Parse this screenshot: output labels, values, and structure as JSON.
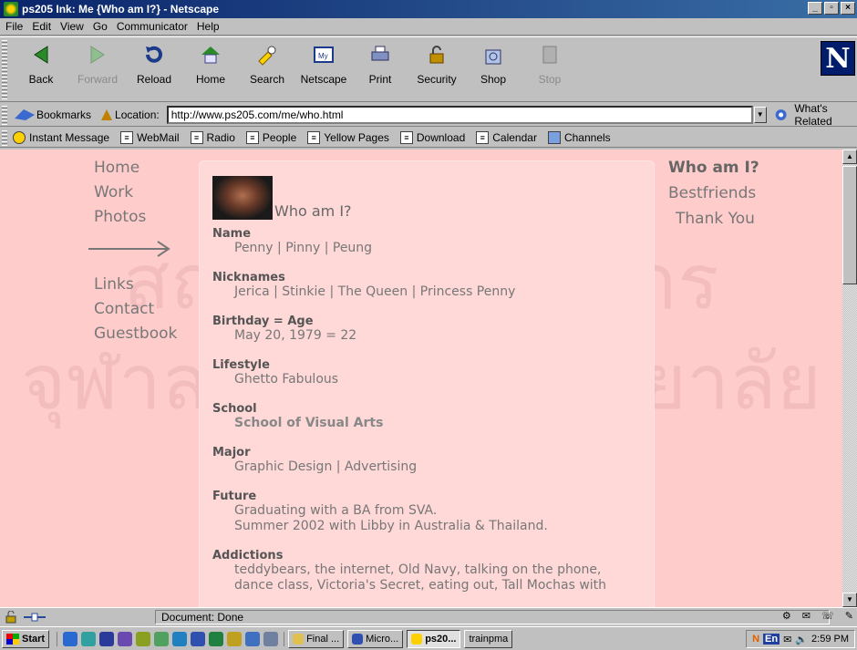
{
  "window": {
    "title": "ps205 Ink: Me {Who am I?} - Netscape",
    "controls": [
      "_",
      "▫",
      "×"
    ]
  },
  "menu": [
    "File",
    "Edit",
    "View",
    "Go",
    "Communicator",
    "Help"
  ],
  "nav_toolbar": {
    "buttons": [
      {
        "label": "Back",
        "enabled": true
      },
      {
        "label": "Forward",
        "enabled": false
      },
      {
        "label": "Reload",
        "enabled": true
      },
      {
        "label": "Home",
        "enabled": true
      },
      {
        "label": "Search",
        "enabled": true
      },
      {
        "label": "Netscape",
        "enabled": true
      },
      {
        "label": "Print",
        "enabled": true
      },
      {
        "label": "Security",
        "enabled": true
      },
      {
        "label": "Shop",
        "enabled": true
      },
      {
        "label": "Stop",
        "enabled": false
      }
    ],
    "logo": "N"
  },
  "location_bar": {
    "bookmarks_label": "Bookmarks",
    "location_label": "Location:",
    "url": "http://www.ps205.com/me/who.html",
    "related_label": "What's Related"
  },
  "personal_toolbar": [
    "Instant Message",
    "WebMail",
    "Radio",
    "People",
    "Yellow Pages",
    "Download",
    "Calendar",
    "Channels"
  ],
  "page": {
    "watermark_line1": "สถาบันวิทยบริการ",
    "watermark_line2": "จุฬาลงกรณ์มหาวิทยาลัย",
    "left_nav_top": [
      "Home",
      "Work",
      "Photos"
    ],
    "left_nav_bottom": [
      "Links",
      "Contact",
      "Guestbook"
    ],
    "right_nav": [
      "Who am I?",
      "Bestfriends",
      "Thank You"
    ],
    "heading": "Who am I?",
    "sections": [
      {
        "title": "Name",
        "lines": [
          "Penny | Pinny | Peung"
        ]
      },
      {
        "title": "Nicknames",
        "lines": [
          "Jerica | Stinkie | The Queen | Princess Penny"
        ]
      },
      {
        "title": "Birthday = Age",
        "lines": [
          "May 20, 1979 = 22"
        ]
      },
      {
        "title": "Lifestyle",
        "lines": [
          "Ghetto Fabulous"
        ]
      },
      {
        "title": "School",
        "lines": [
          "School of Visual Arts"
        ]
      },
      {
        "title": "Major",
        "lines": [
          "Graphic Design | Advertising"
        ]
      },
      {
        "title": "Future",
        "lines": [
          "Graduating with a BA from SVA.",
          "Summer 2002 with Libby in Australia & Thailand."
        ]
      },
      {
        "title": "Addictions",
        "lines": [
          "teddybears, the internet, Old Navy, talking on the phone,",
          "dance class, Victoria's Secret, eating out, Tall Mochas with"
        ]
      }
    ]
  },
  "status": {
    "text": "Document: Done"
  },
  "taskbar": {
    "start": "Start",
    "tasks": [
      {
        "label": "Final ...",
        "active": false
      },
      {
        "label": "Micro...",
        "active": false
      },
      {
        "label": "ps20...",
        "active": true
      },
      {
        "label": "trainpma",
        "active": false
      }
    ],
    "clock": "2:59 PM",
    "lang": "En"
  }
}
